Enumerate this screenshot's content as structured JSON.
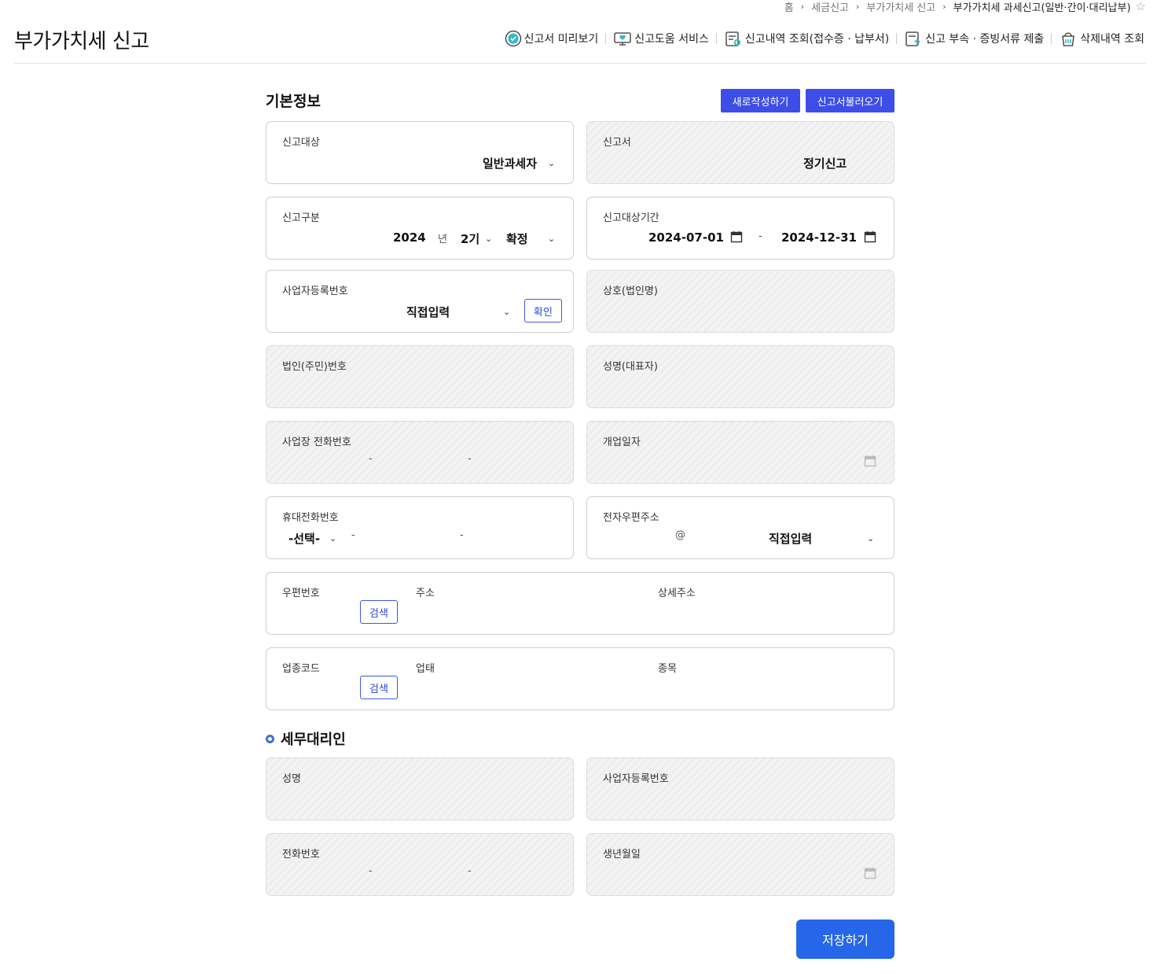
{
  "breadcrumb": {
    "items": [
      "홈",
      "세금신고",
      "부가가치세 신고",
      "부가가치세 과세신고(일반·간이·대리납부)"
    ],
    "separator": "›"
  },
  "page_title": "부가가치세 신고",
  "top_menu": [
    {
      "label": "신고서 미리보기",
      "icon": "check-circle-icon"
    },
    {
      "label": "신고도움 서비스",
      "icon": "monitor-heart-icon"
    },
    {
      "label": "신고내역 조회(접수증 · 납부서)",
      "icon": "document-search-icon"
    },
    {
      "label": "신고 부속 · 증빙서류 제출",
      "icon": "document-upload-icon"
    },
    {
      "label": "삭제내역 조회",
      "icon": "trash-bag-icon"
    }
  ],
  "basic_info": {
    "title": "기본정보",
    "new_button": "새로작성하기",
    "load_button": "신고서불러오기",
    "report_target": {
      "label": "신고대상",
      "value": "일반과세자"
    },
    "report_form": {
      "label": "신고서",
      "value": "정기신고"
    },
    "report_type": {
      "label": "신고구분",
      "year": "2024",
      "year_unit": "년",
      "term": "2기",
      "kind": "확정"
    },
    "period": {
      "label": "신고대상기간",
      "start": "2024-07-01",
      "separator": "-",
      "end": "2024-12-31"
    },
    "business_no": {
      "label": "사업자등록번호",
      "value": "직접입력",
      "confirm": "확인"
    },
    "company_name": {
      "label": "상호(법인명)"
    },
    "corp_no": {
      "label": "법인(주민)번호"
    },
    "rep_name": {
      "label": "성명(대표자)"
    },
    "biz_phone": {
      "label": "사업장 전화번호",
      "dash": "-"
    },
    "open_date": {
      "label": "개업일자"
    },
    "mobile": {
      "label": "휴대전화번호",
      "select": "-선택-",
      "dash": "-"
    },
    "email": {
      "label": "전자우편주소",
      "at": "@",
      "domain": "직접입력"
    },
    "address": {
      "zip_label": "우편번호",
      "search": "검색",
      "addr_label": "주소",
      "detail_label": "상세주소"
    },
    "industry": {
      "code_label": "업종코드",
      "search": "검색",
      "type_label": "업태",
      "item_label": "종목"
    }
  },
  "tax_agent": {
    "title": "세무대리인",
    "name": {
      "label": "성명"
    },
    "business_no": {
      "label": "사업자등록번호"
    },
    "phone": {
      "label": "전화번호",
      "dash": "-"
    },
    "birth": {
      "label": "생년월일"
    }
  },
  "save_button": "저장하기",
  "colors": {
    "primary": "#3d4ee8",
    "save": "#2567e8",
    "outline": "#3d5adf"
  }
}
